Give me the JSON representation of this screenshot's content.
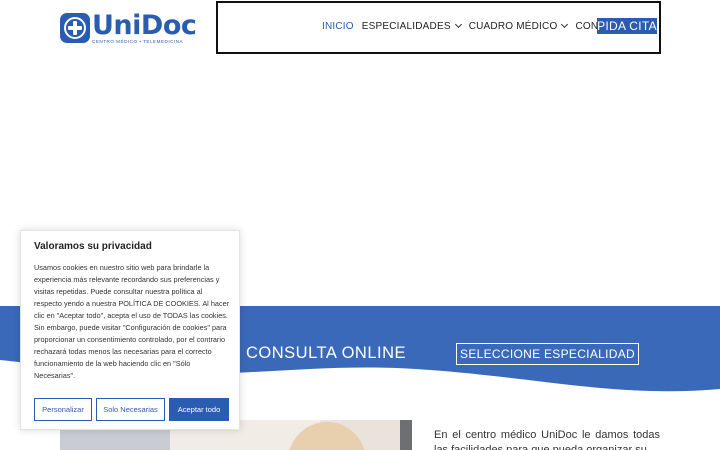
{
  "colors": {
    "brand": "#2a5db0",
    "band": "#3a69b9"
  },
  "logo": {
    "name": "UniDoc",
    "tagline": "CENTRO MÉDICO • TELEMEDICINA"
  },
  "nav": {
    "items": [
      {
        "label": "INICIO",
        "active": true,
        "dropdown": false
      },
      {
        "label": "ESPECIALIDADES",
        "active": false,
        "dropdown": true
      },
      {
        "label": "CUADRO MÉDICO",
        "active": false,
        "dropdown": true
      },
      {
        "label": "CONTACTO",
        "active": false,
        "dropdown": false
      }
    ],
    "cta": "PIDA CITA"
  },
  "band": {
    "title": "CONSULTA ONLINE",
    "button": "SELECCIONE ESPECIALIDAD"
  },
  "intro": {
    "text": "En el centro médico UniDoc le damos todas las facilidades para que pueda organizar su"
  },
  "cookie": {
    "title": "Valoramos su privacidad",
    "text": "Usamos cookies en nuestro sitio web para brindarle la experiencia más relevante recordando sus preferencias y visitas repetidas. Puede consultar nuestra política al respecto yendo a nuestra POLÍTICA DE COOKIES. Al hacer clic en \"Aceptar todo\", acepta el uso de TODAS las cookies. Sin embargo, puede visitar \"Configuración de cookies\" para proporcionar un consentimiento controlado, por el contrario rechazará todas menos las necesarias para el correcto funcionamiento de la web haciendo clic en \"Sólo Necesarias\".",
    "buttons": {
      "customize": "Personalizar",
      "necessary": "Solo Necesarias",
      "accept": "Aceptar todo"
    }
  }
}
